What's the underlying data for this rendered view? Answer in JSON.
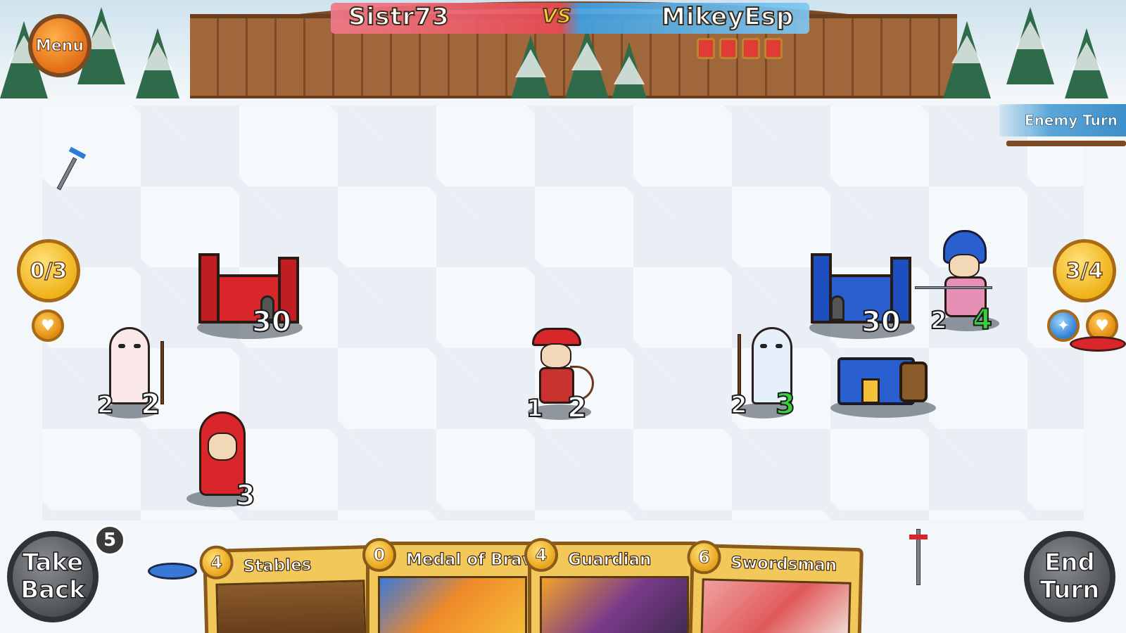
{
  "header": {
    "player_left": "Sistr73",
    "vs": "VS",
    "player_right": "MikeyEsp",
    "enemy_hand_count": 4
  },
  "menu": {
    "label": "Menu"
  },
  "turn_indicator": {
    "label": "Enemy Turn"
  },
  "player_left_panel": {
    "mana": "0/3",
    "power_icon": "gold-shield-icon"
  },
  "player_right_panel": {
    "mana": "3/4",
    "power_icons": [
      "blue-gem-icon",
      "gold-shield-icon"
    ]
  },
  "units": {
    "red_castle": {
      "health": "30"
    },
    "blue_castle": {
      "health": "30"
    },
    "red_ghost": {
      "attack": "2",
      "health": "2"
    },
    "red_hood": {
      "health": "3"
    },
    "red_archer": {
      "attack": "1",
      "health": "2"
    },
    "blue_ghost": {
      "attack": "2",
      "health": "3"
    },
    "blue_trident": {
      "attack": "2",
      "health": "4"
    }
  },
  "take_back": {
    "line1": "Take",
    "line2": "Back",
    "count": "5"
  },
  "end_turn": {
    "line1": "End",
    "line2": "Turn"
  },
  "hand": [
    {
      "cost": "4",
      "name": "Stables"
    },
    {
      "cost": "0",
      "name": "Medal of Bravery"
    },
    {
      "cost": "4",
      "name": "Guardian"
    },
    {
      "cost": "6",
      "name": "Swordsman"
    }
  ],
  "colors": {
    "red_team": "#d8262a",
    "blue_team": "#2a5fd0",
    "green_stat": "#38d13a",
    "gold": "#f0b21a"
  }
}
